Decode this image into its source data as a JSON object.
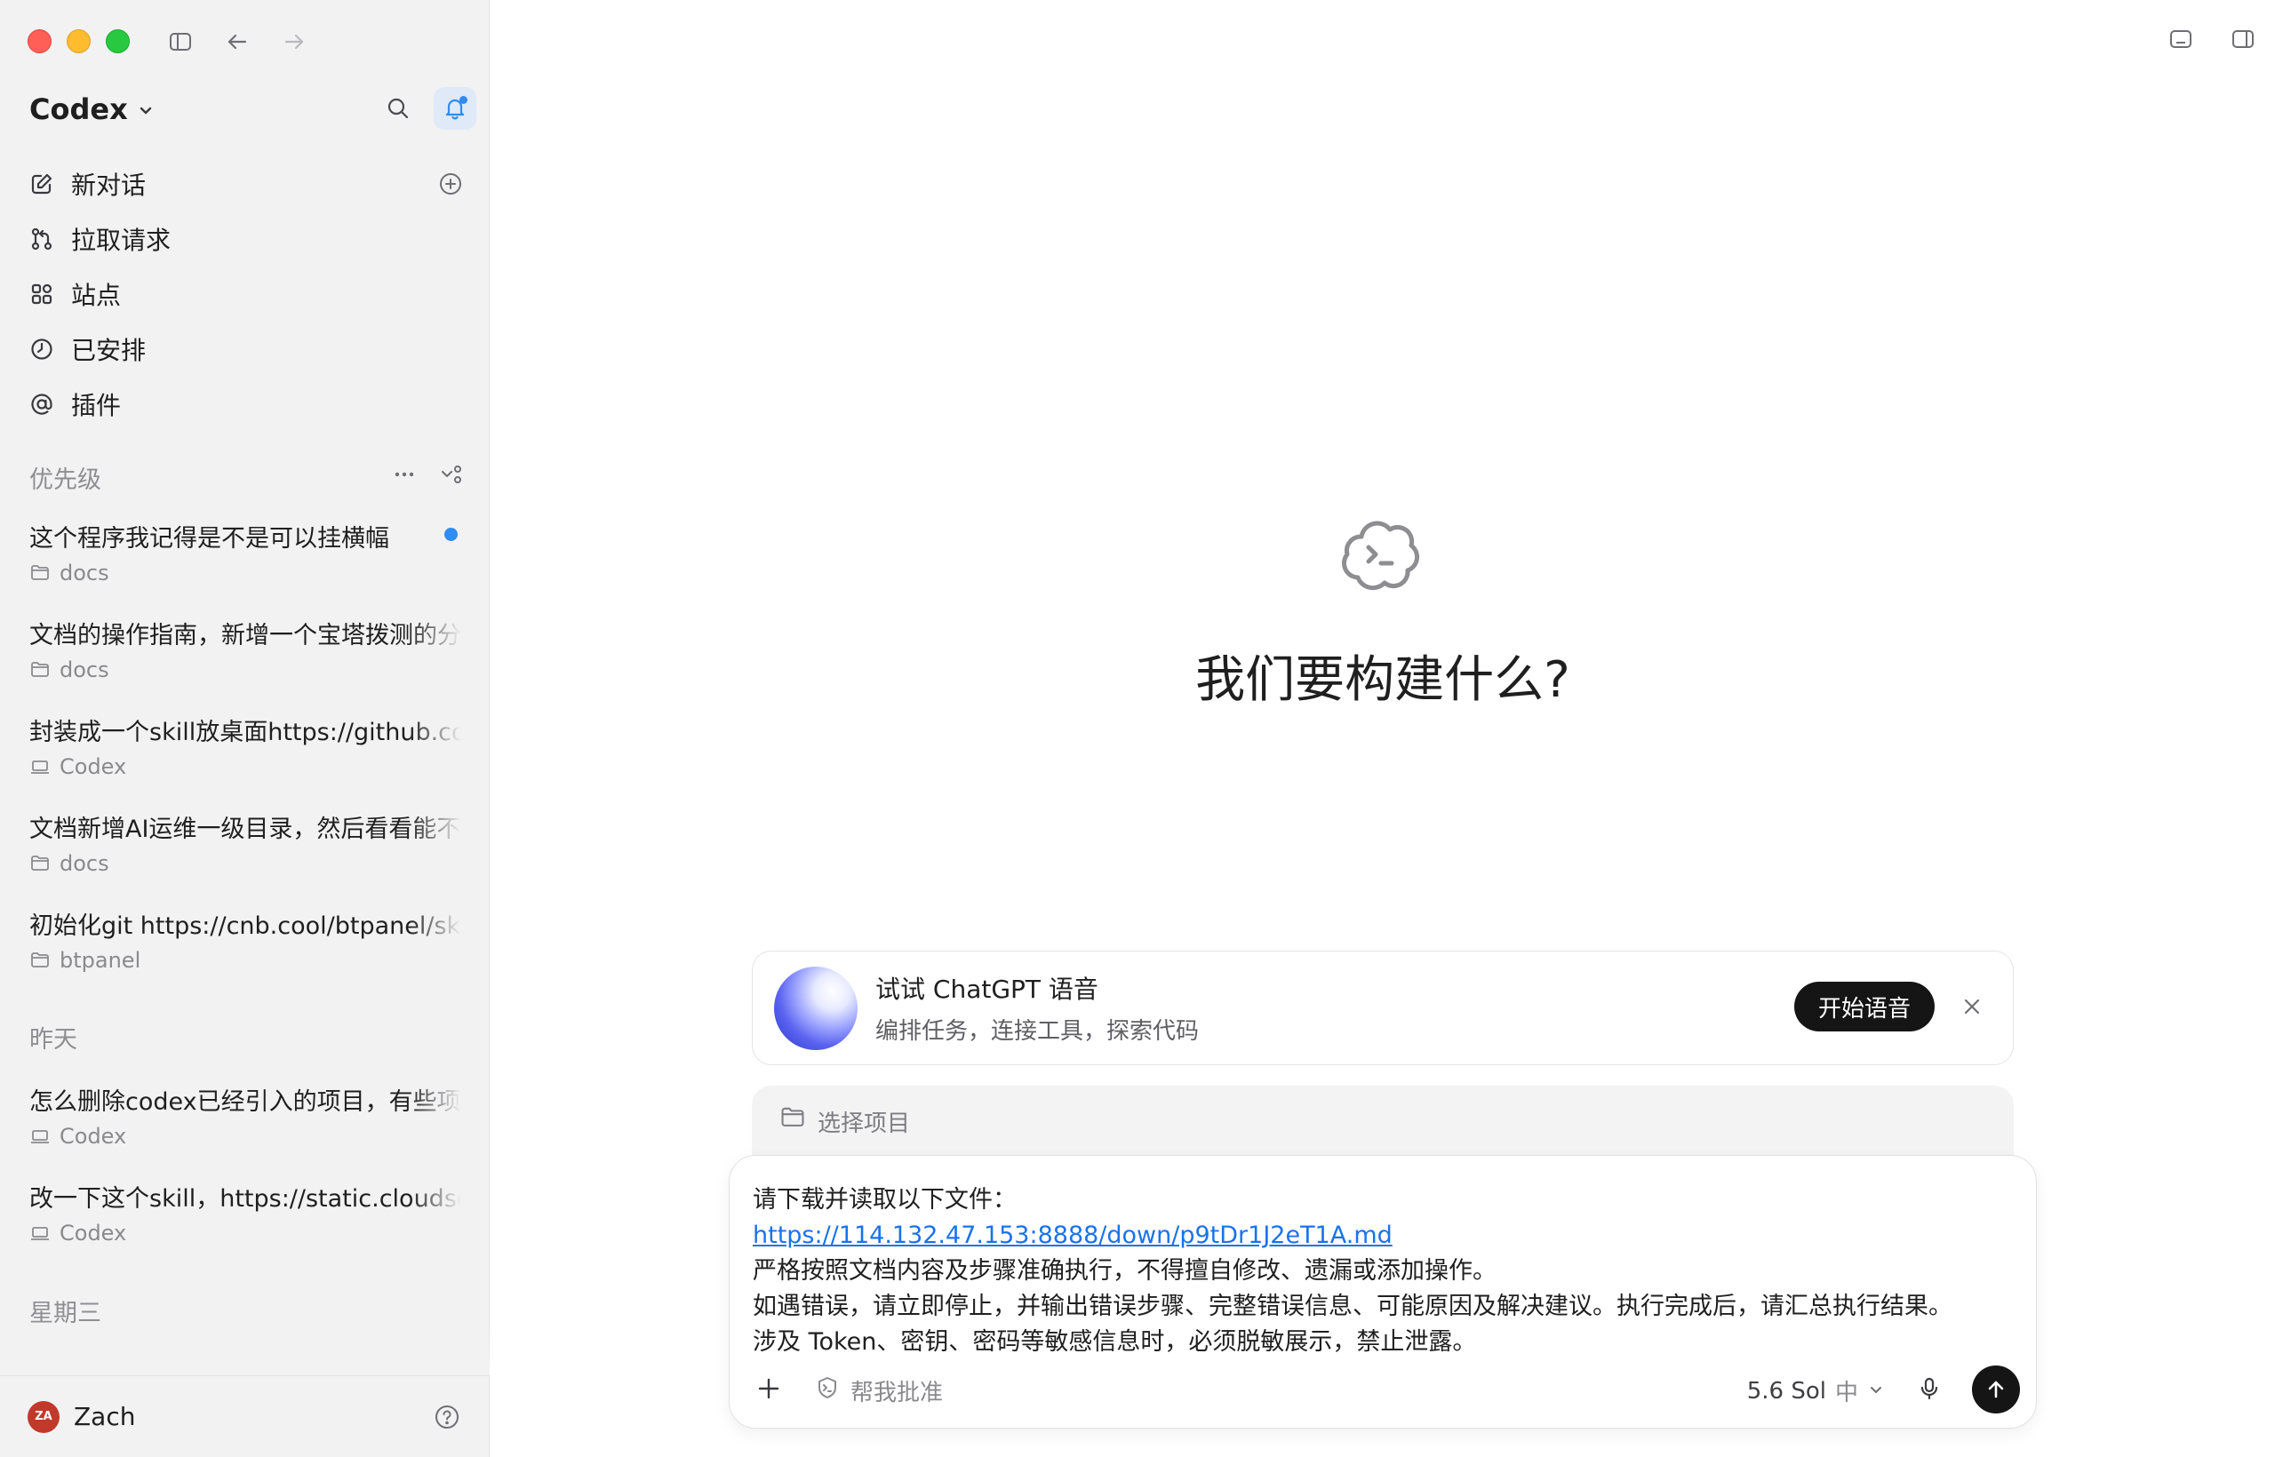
{
  "window": {
    "traffic_lights": [
      "close",
      "minimize",
      "zoom"
    ]
  },
  "sidebar": {
    "brand": "Codex",
    "nav": [
      {
        "label": "新对话",
        "icon": "edit-icon"
      },
      {
        "label": "拉取请求",
        "icon": "pull-request-icon"
      },
      {
        "label": "站点",
        "icon": "grid-icon"
      },
      {
        "label": "已安排",
        "icon": "clock-icon"
      },
      {
        "label": "插件",
        "icon": "at-icon"
      }
    ],
    "sections": [
      {
        "label": "优先级",
        "threads": [
          {
            "title": "这个程序我记得是不是可以挂横幅",
            "project": "docs",
            "project_icon": "folder-icon",
            "unread": true
          },
          {
            "title": "文档的操作指南，新增一个宝塔拨测的分",
            "project": "docs",
            "project_icon": "folder-icon",
            "unread": false
          },
          {
            "title": "封装成一个skill放桌面https://github.com",
            "project": "Codex",
            "project_icon": "laptop-icon",
            "unread": false
          },
          {
            "title": "文档新增AI运维一级目录，然后看看能不",
            "project": "docs",
            "project_icon": "folder-icon",
            "unread": false
          },
          {
            "title": "初始化git https://cnb.cool/btpanel/skill",
            "project": "btpanel",
            "project_icon": "folder-icon",
            "unread": false
          }
        ]
      },
      {
        "label": "昨天",
        "threads": [
          {
            "title": "怎么删除codex已经引入的项目，有些项",
            "project": "Codex",
            "project_icon": "laptop-icon",
            "unread": false
          },
          {
            "title": "改一下这个skill，https://static.cloudse",
            "project": "Codex",
            "project_icon": "laptop-icon",
            "unread": false
          }
        ]
      },
      {
        "label": "星期三",
        "threads": []
      }
    ],
    "user": {
      "initials": "ZA",
      "name": "Zach",
      "avatar_color": "#c0392b"
    }
  },
  "main": {
    "title": "我们要构建什么?",
    "promo": {
      "title": "试试 ChatGPT 语音",
      "subtitle": "编排任务，连接工具，探索代码",
      "button": "开始语音"
    },
    "project_picker": "选择项目",
    "composer": {
      "lines": [
        "请下载并读取以下文件：",
        "https://114.132.47.153:8888/down/p9tDr1J2eT1A.md",
        "严格按照文档内容及步骤准确执行，不得擅自修改、遗漏或添加操作。",
        "如遇错误，请立即停止，并输出错误步骤、完整错误信息、可能原因及解决建议。执行完成后，请汇总执行结果。",
        "涉及 Token、密钥、密码等敏感信息时，必须脱敏展示，禁止泄露。"
      ],
      "approval_label": "帮我批准",
      "model": "5.6 Sol",
      "effort": "中"
    }
  },
  "colors": {
    "accent": "#2f8cf0",
    "sidebar_bg": "#f2f2f3",
    "button_dark": "#151515",
    "link": "#1a73e8"
  }
}
